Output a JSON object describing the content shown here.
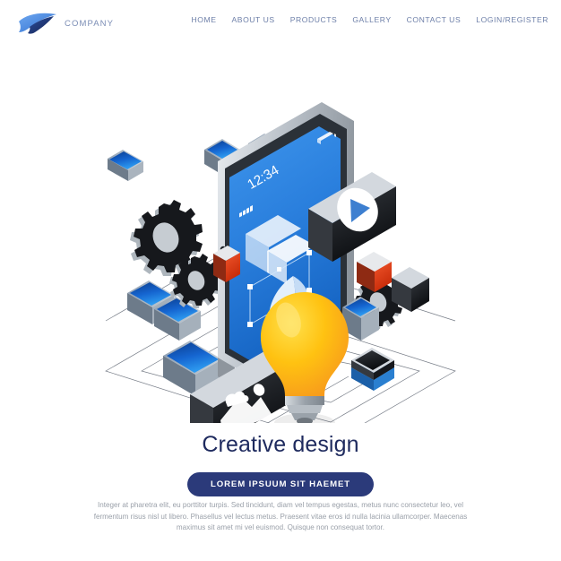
{
  "header": {
    "brand_name": "COMPANY",
    "logo_icon": "wing-bird-logo-icon",
    "nav_items": [
      {
        "label": "HOME"
      },
      {
        "label": "ABOUT US"
      },
      {
        "label": "PRODUCTS"
      },
      {
        "label": "GALLERY"
      },
      {
        "label": "CONTACT US"
      },
      {
        "label": "LOGIN/REGISTER"
      }
    ]
  },
  "illustration": {
    "alt": "isometric smartphone with design tools, gears, light bulb and floating cards",
    "phone": {
      "status_time": "12:34",
      "signal_icon": "signal-bars-icon",
      "battery_icon": "battery-icon",
      "canvas_icon": "vector-leaf-shape-icon",
      "shapes_icon": "overlapping-squares-icon"
    },
    "elements": [
      {
        "name": "gear-large-icon"
      },
      {
        "name": "gear-medium-icon"
      },
      {
        "name": "gear-small-icon"
      },
      {
        "name": "play-button-card-icon"
      },
      {
        "name": "image-gallery-card-icon"
      },
      {
        "name": "light-bulb-icon"
      },
      {
        "name": "blue-card-icon"
      },
      {
        "name": "red-card-icon"
      },
      {
        "name": "black-card-icon"
      },
      {
        "name": "isometric-grid-lines"
      }
    ],
    "colors": {
      "blue_card": "#1a73d8",
      "blue_card_dark": "#0b3f8f",
      "red_card": "#e8411e",
      "black_card": "#14161a",
      "bulb_yellow": "#ffc211",
      "bulb_orange": "#f79421",
      "screen_blue": "#2e86e0",
      "screen_blue_dark": "#1769c8",
      "phone_frame": "#b9bfc6"
    }
  },
  "content": {
    "headline": "Creative design",
    "cta_label": "LOREM IPSUUM SIT HAEMET",
    "paragraph": "Integer at pharetra elit, eu porttitor turpis. Sed tincidunt, diam vel tempus egestas, metus nunc consectetur leo, vel fermentum risus nisl ut libero. Phasellus vel lectus metus. Praesent vitae eros id nulla lacinia ullamcorper. Maecenas maximus sit amet mi vel euismod. Quisque non consequat tortor."
  },
  "theme": {
    "accent_navy": "#2b3a7a",
    "heading_color": "#1e2a5e",
    "nav_color": "#6d7fa8",
    "body_color": "#9aa0a9",
    "background": "#ffffff"
  }
}
